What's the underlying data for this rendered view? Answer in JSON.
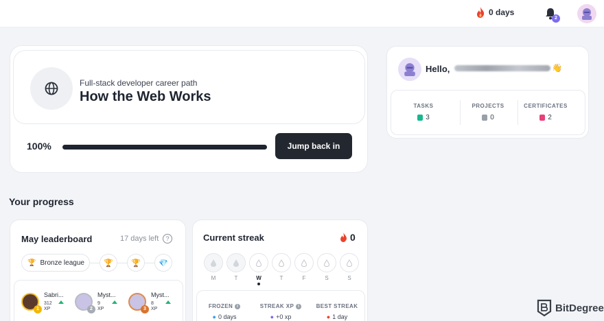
{
  "topbar": {
    "streak_label": "0 days",
    "notification_count": "2"
  },
  "course": {
    "subtitle": "Full-stack developer career path",
    "title": "How the Web Works",
    "progress_label": "100%",
    "progress": 1.0,
    "button_label": "Jump back in"
  },
  "profile": {
    "greeting": "Hello,",
    "stats": [
      {
        "label": "TASKS",
        "value": "3",
        "icon": "book-icon",
        "color": "#17b890"
      },
      {
        "label": "PROJECTS",
        "value": "0",
        "icon": "puzzle-icon",
        "color": "#9aa0aa"
      },
      {
        "label": "CERTIFICATES",
        "value": "2",
        "icon": "certificate-icon",
        "color": "#e8417a"
      }
    ]
  },
  "progress_section": {
    "title": "Your progress"
  },
  "leaderboard": {
    "title": "May leaderboard",
    "days_left": "17 days left",
    "help": "?",
    "league": "Bronze league",
    "players": [
      {
        "name": "Sabri...",
        "xp": "312",
        "xp_unit": "XP",
        "rank": "1"
      },
      {
        "name": "Myst...",
        "xp": "9",
        "xp_unit": "XP",
        "rank": "2"
      },
      {
        "name": "Myst...",
        "xp": "8",
        "xp_unit": "XP",
        "rank": "3"
      }
    ]
  },
  "streak": {
    "title": "Current streak",
    "count": "0",
    "days": [
      "M",
      "T",
      "W",
      "T",
      "F",
      "S",
      "S"
    ],
    "stats": [
      {
        "label": "FROZEN",
        "value": "0 days",
        "info": "i"
      },
      {
        "label": "STREAK XP",
        "value": "+0 xp",
        "info": "i"
      },
      {
        "label": "BEST STREAK",
        "value": "1 day"
      }
    ]
  },
  "watermark": {
    "text": "BitDegree"
  },
  "colors": {
    "accent": "#7c6cf0",
    "dark_button": "#23272f",
    "fire": "#e8432d",
    "up": "#22b573"
  }
}
